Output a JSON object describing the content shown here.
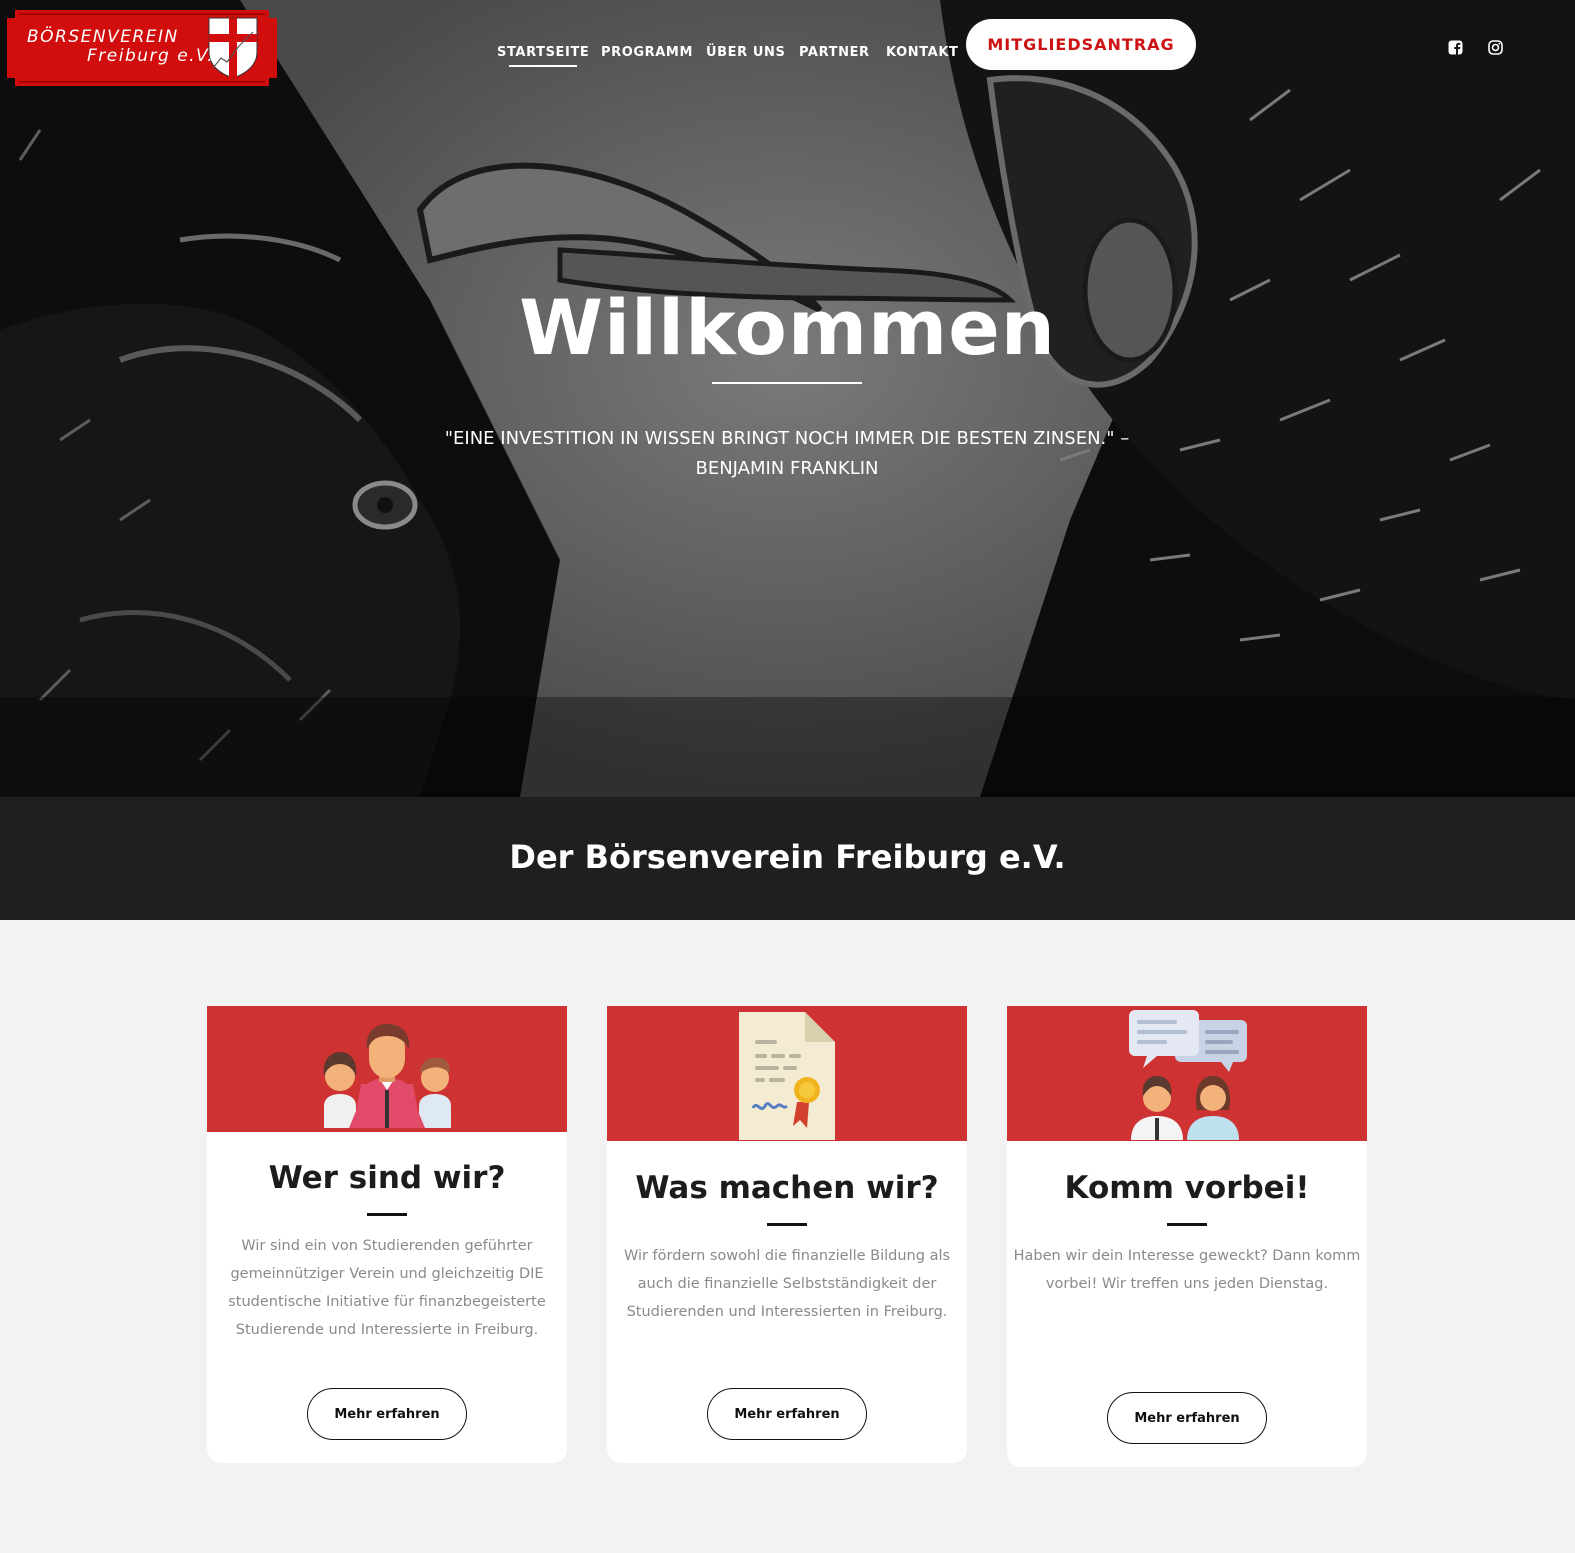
{
  "logo": {
    "line1": "BÖRSENVEREIN",
    "line2": "Freiburg e.V.",
    "colors": {
      "red": "#d10d0d",
      "shield": "#ffffff"
    }
  },
  "nav": {
    "items": [
      {
        "label": "STARTSEITE",
        "active": true
      },
      {
        "label": "PROGRAMM",
        "active": false
      },
      {
        "label": "ÜBER UNS",
        "active": false
      },
      {
        "label": "PARTNER",
        "active": false
      },
      {
        "label": "KONTAKT",
        "active": false
      }
    ],
    "cta_label": "MITGLIEDSANTRAG"
  },
  "social": {
    "icons": [
      "facebook-icon",
      "instagram-icon"
    ]
  },
  "hero": {
    "title": "Willkommen",
    "quote_line1": "\"EINE INVESTITION IN WISSEN BRINGT NOCH IMMER DIE BESTEN ZINSEN.\" –",
    "quote_line2": "BENJAMIN FRANKLIN"
  },
  "band": {
    "title": "Der Börsenverein Freiburg e.V."
  },
  "cards": [
    {
      "icon": "team-icon",
      "title": "Wer sind wir?",
      "text": "Wir sind ein von Studierenden geführter gemeinnütziger Verein und gleichzeitig DIE studentische Initiative für finanzbegeisterte Studierende und Interessierte in Freiburg.",
      "button": "Mehr erfahren"
    },
    {
      "icon": "certificate-icon",
      "title": "Was machen wir?",
      "text": "Wir fördern sowohl die finanzielle Bildung als auch die finanzielle Selbstständigkeit der Studierenden und Interessierten in Freiburg.",
      "button": "Mehr erfahren"
    },
    {
      "icon": "conversation-icon",
      "title": "Komm vorbei!",
      "text": "Haben wir dein Interesse geweckt? Dann komm vorbei! Wir treffen uns jeden Dienstag.",
      "button": "Mehr erfahren"
    }
  ],
  "colors": {
    "accent_red": "#cf3232",
    "cta_red": "#cc1212",
    "dark_band": "#1f1f1f",
    "page_bg": "#f2f2f2"
  }
}
